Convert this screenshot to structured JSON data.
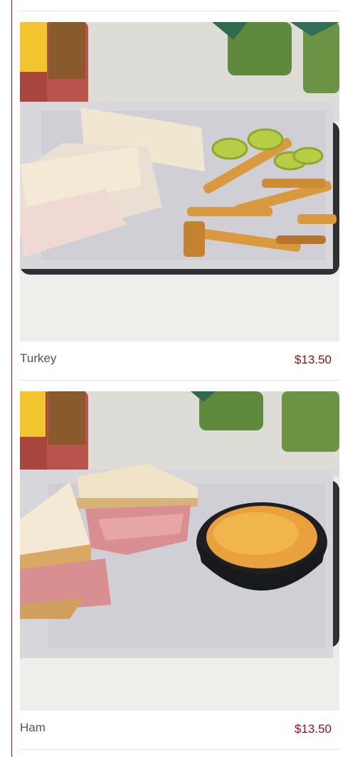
{
  "menu": {
    "items": [
      {
        "name": "Turkey",
        "price": "$13.50",
        "image_subject": "turkey sandwich with fries and jalapeños on a tray"
      },
      {
        "name": "Ham",
        "price": "$13.50",
        "image_subject": "ham sandwich with mac and cheese cup on a tray"
      }
    ]
  },
  "colors": {
    "price": "#8b1212",
    "name": "#555555",
    "accent_rule": "#8b1a1a"
  }
}
